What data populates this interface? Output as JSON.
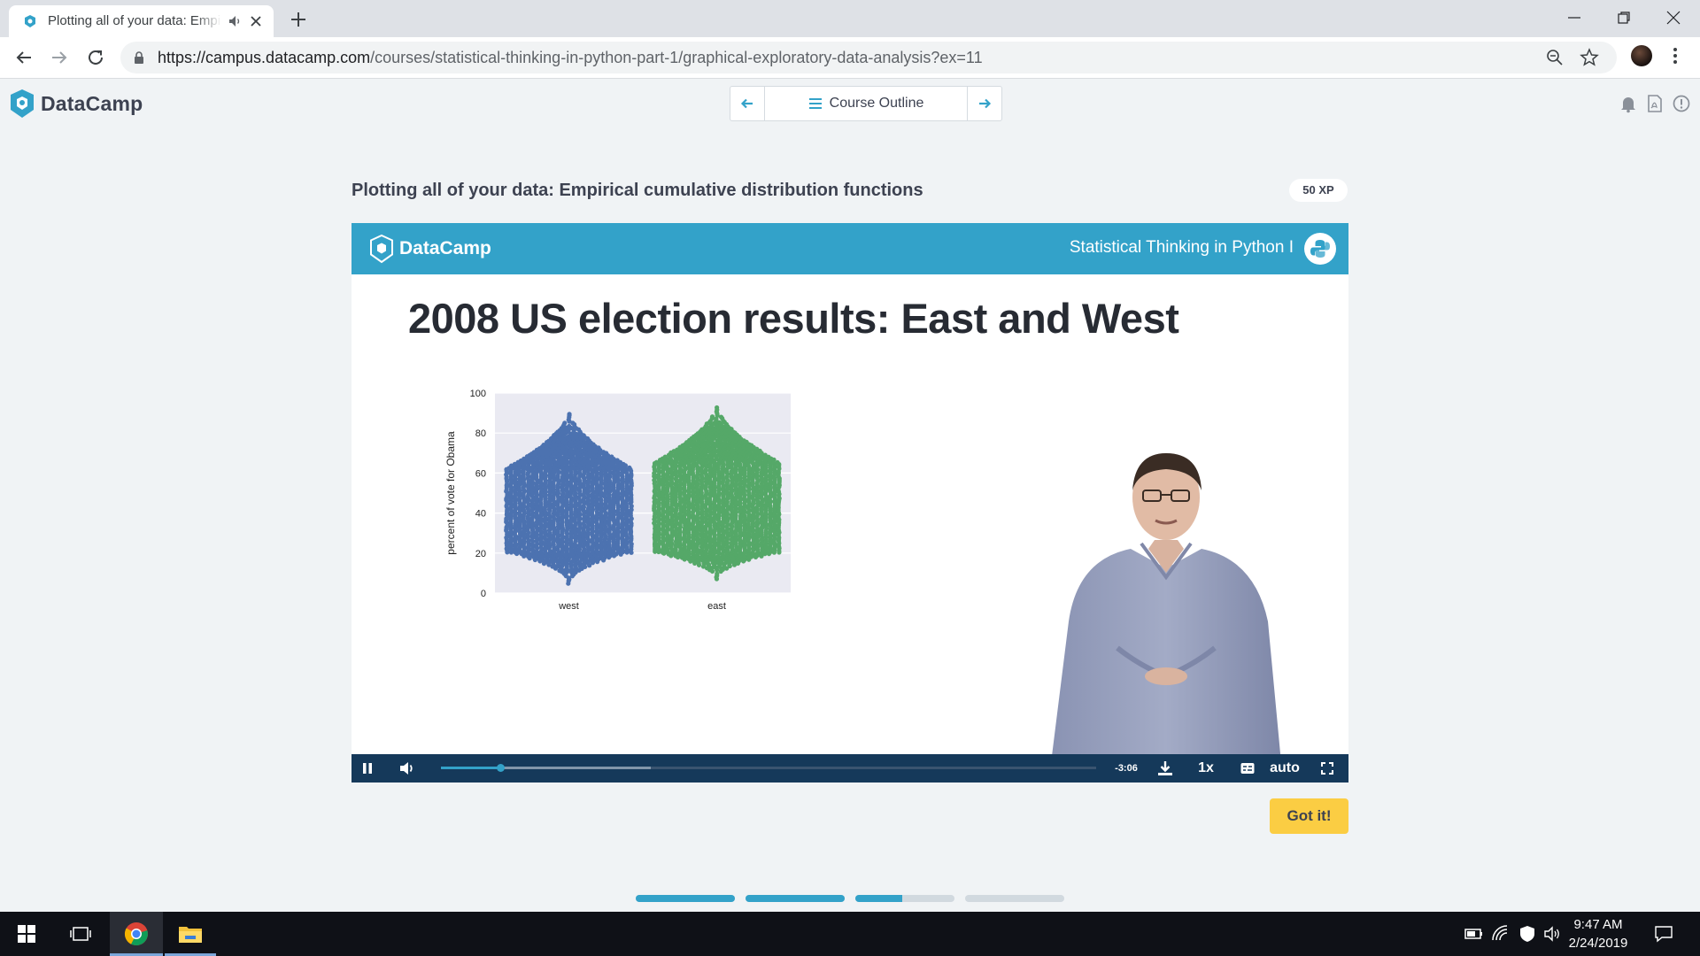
{
  "browser": {
    "tab_title": "Plotting all of your data: Empirical cumulative distribution functions",
    "url_host": "https://campus.datacamp.com",
    "url_path": "/courses/statistical-thinking-in-python-part-1/graphical-exploratory-data-analysis?ex=11"
  },
  "header": {
    "logo_text": "DataCamp",
    "course_outline_label": "Course Outline"
  },
  "exercise": {
    "title": "Plotting all of your data: Empirical cumulative distribution functions",
    "xp": "50 XP",
    "got_it_label": "Got it!",
    "steps_progress": [
      1,
      1,
      0.47,
      0
    ]
  },
  "video": {
    "slide_logo_text": "DataCamp",
    "course_name": "Statistical Thinking in Python I",
    "slide_title": "2008 US election results: East and West",
    "time_remaining": "-3:06",
    "speed": "1x",
    "quality": "auto",
    "played_fraction": 0.09,
    "buffered_fraction": 0.32
  },
  "chart_data": {
    "type": "scatter",
    "subtype": "swarm",
    "categories": [
      "west",
      "east"
    ],
    "ylabel": "percent of vote for Obama",
    "ylim": [
      0,
      100
    ],
    "yticks": [
      0,
      20,
      40,
      60,
      80,
      100
    ],
    "grid": true,
    "series": [
      {
        "category": "west",
        "color": "#4c72b0",
        "min": 5,
        "max": 90,
        "dense_range": [
          20,
          62
        ]
      },
      {
        "category": "east",
        "color": "#55a868",
        "min": 7,
        "max": 93,
        "dense_range": [
          20,
          65
        ]
      }
    ]
  },
  "taskbar": {
    "time": "9:47 AM",
    "date": "2/24/2019"
  },
  "colors": {
    "brand_blue": "#33a2c9",
    "player_bar": "#15395a",
    "got_it_yellow": "#fbcd43"
  }
}
